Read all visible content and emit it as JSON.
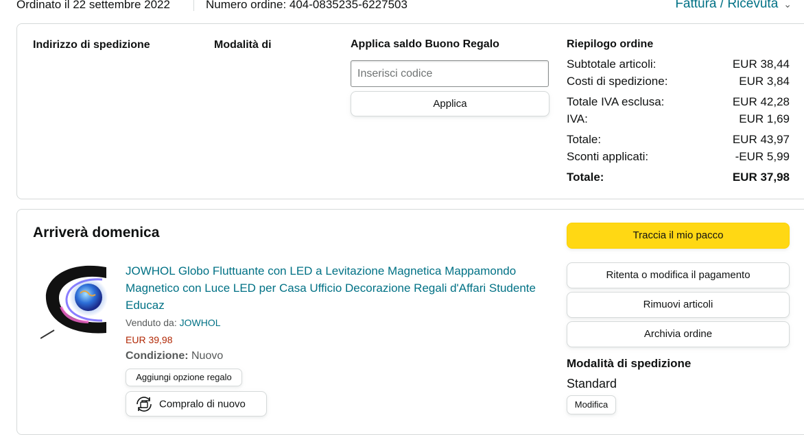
{
  "header": {
    "order_date": "Ordinato il 22 settembre 2022",
    "order_number": "Numero ordine: 404-0835235-6227503",
    "invoice_link": "Fattura / Ricevuta"
  },
  "summary_card": {
    "shipping_address_title": "Indirizzo di spedizione",
    "payment_method_title": "Modalità di",
    "gift_card_title": "Applica saldo Buono Regalo",
    "code_placeholder": "Inserisci codice",
    "apply_label": "Applica",
    "order_summary_title": "Riepilogo ordine",
    "rows": [
      {
        "label": "Subtotale articoli:",
        "value": "EUR 38,44"
      },
      {
        "label": "Costi di spedizione:",
        "value": "EUR 3,84"
      },
      {
        "label": "Totale IVA esclusa:",
        "value": "EUR 42,28"
      },
      {
        "label": "IVA:",
        "value": "EUR 1,69"
      },
      {
        "label": "Totale:",
        "value": "EUR 43,97"
      },
      {
        "label": "Sconti applicati:",
        "value": "-EUR 5,99"
      },
      {
        "label": "Totale:",
        "value": "EUR 37,98"
      }
    ]
  },
  "shipment": {
    "arrival": "Arriverà domenica",
    "product_title": "JOWHOL Globo Fluttuante con LED a Levitazione Magnetica Mappamondo Magnetico con Luce LED per Casa Ufficio Decorazione Regali d'Affari Studente Educaz",
    "sold_by_label": "Venduto da:",
    "seller": "JOWHOL",
    "price": "EUR 39,98",
    "condition_label": "Condizione:",
    "condition_value": "Nuovo",
    "gift_option_label": "Aggiungi opzione regalo",
    "buy_again_label": "Compralo di nuovo",
    "track_label": "Traccia il mio pacco",
    "retry_payment_label": "Ritenta o modifica il pagamento",
    "remove_items_label": "Rimuovi articoli",
    "archive_label": "Archivia ordine",
    "shipping_method_title": "Modalità di spedizione",
    "shipping_method_value": "Standard",
    "modify_label": "Modifica"
  },
  "icons": {
    "invoice_chevron": "chevron-down-icon",
    "buy_again": "reorder-icon",
    "product_image": "magnetic-levitation-globe-image"
  },
  "colors": {
    "link": "#007185",
    "price": "#b12704",
    "primary_button": "#ffd814",
    "border": "#d5d9d9"
  }
}
